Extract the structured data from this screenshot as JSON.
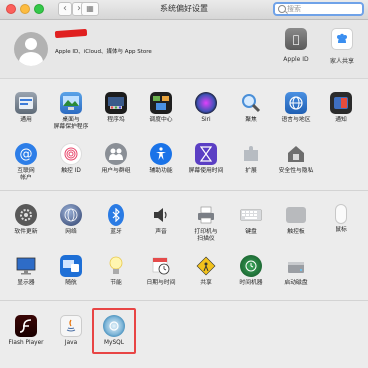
{
  "window": {
    "title": "系统偏好设置"
  },
  "search": {
    "placeholder": "搜索"
  },
  "account": {
    "description": "Apple ID、iCloud、媒体与 App Store",
    "items": [
      {
        "label": "Apple ID",
        "icon": "apple-id-icon"
      },
      {
        "label": "家人共享",
        "icon": "family-sharing-icon"
      }
    ]
  },
  "panes": {
    "row1": [
      {
        "label": "通用",
        "icon": "general-icon"
      },
      {
        "label": "桌面与\n屏幕保护程序",
        "icon": "desktop-screensaver-icon"
      },
      {
        "label": "程序坞",
        "icon": "dock-icon"
      },
      {
        "label": "调度中心",
        "icon": "mission-control-icon"
      },
      {
        "label": "Siri",
        "icon": "siri-icon"
      },
      {
        "label": "聚焦",
        "icon": "spotlight-icon"
      },
      {
        "label": "语言与地区",
        "icon": "language-region-icon"
      },
      {
        "label": "通知",
        "icon": "notifications-icon"
      }
    ],
    "row2": [
      {
        "label": "互联网\n帐户",
        "icon": "internet-accounts-icon"
      },
      {
        "label": "触控 ID",
        "icon": "touch-id-icon"
      },
      {
        "label": "用户与群组",
        "icon": "users-groups-icon"
      },
      {
        "label": "辅助功能",
        "icon": "accessibility-icon"
      },
      {
        "label": "屏幕使用时间",
        "icon": "screen-time-icon"
      },
      {
        "label": "扩展",
        "icon": "extensions-icon"
      },
      {
        "label": "安全性与隐私",
        "icon": "security-privacy-icon"
      }
    ],
    "row3": [
      {
        "label": "软件更新",
        "icon": "software-update-icon"
      },
      {
        "label": "网络",
        "icon": "network-icon"
      },
      {
        "label": "蓝牙",
        "icon": "bluetooth-icon"
      },
      {
        "label": "声音",
        "icon": "sound-icon"
      },
      {
        "label": "打印机与\n扫描仪",
        "icon": "printers-scanners-icon"
      },
      {
        "label": "键盘",
        "icon": "keyboard-icon"
      },
      {
        "label": "触控板",
        "icon": "trackpad-icon"
      },
      {
        "label": "鼠标",
        "icon": "mouse-icon"
      }
    ],
    "row4": [
      {
        "label": "显示器",
        "icon": "displays-icon"
      },
      {
        "label": "随航",
        "icon": "sidecar-icon"
      },
      {
        "label": "节能",
        "icon": "energy-saver-icon"
      },
      {
        "label": "日期与时间",
        "icon": "date-time-icon"
      },
      {
        "label": "共享",
        "icon": "sharing-icon"
      },
      {
        "label": "时间机器",
        "icon": "time-machine-icon"
      },
      {
        "label": "启动磁盘",
        "icon": "startup-disk-icon"
      }
    ],
    "row5": [
      {
        "label": "Flash Player",
        "icon": "flash-player-icon"
      },
      {
        "label": "Java",
        "icon": "java-icon"
      },
      {
        "label": "MySQL",
        "icon": "mysql-icon"
      }
    ]
  }
}
